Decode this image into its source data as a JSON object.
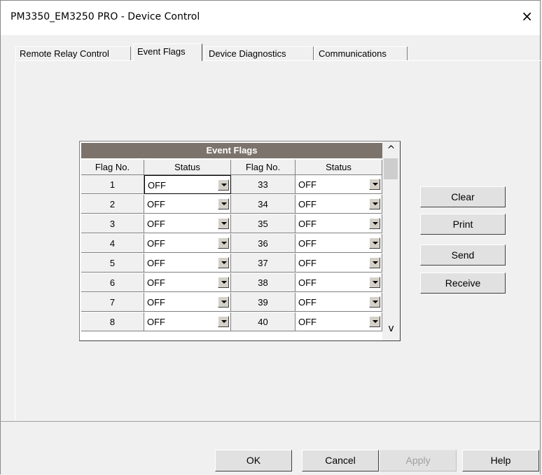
{
  "window": {
    "title": "PM3350_EM3250 PRO - Device Control",
    "close": "×"
  },
  "tabs": [
    {
      "label": "Remote Relay Control"
    },
    {
      "label": "Event Flags"
    },
    {
      "label": "Device Diagnostics"
    },
    {
      "label": "Communications"
    }
  ],
  "grid": {
    "title": "Event Flags",
    "headers": {
      "flag_no": "Flag No.",
      "status": "Status"
    },
    "left": [
      {
        "no": "1",
        "status": "OFF"
      },
      {
        "no": "2",
        "status": "OFF"
      },
      {
        "no": "3",
        "status": "OFF"
      },
      {
        "no": "4",
        "status": "OFF"
      },
      {
        "no": "5",
        "status": "OFF"
      },
      {
        "no": "6",
        "status": "OFF"
      },
      {
        "no": "7",
        "status": "OFF"
      },
      {
        "no": "8",
        "status": "OFF"
      }
    ],
    "right": [
      {
        "no": "33",
        "status": "OFF"
      },
      {
        "no": "34",
        "status": "OFF"
      },
      {
        "no": "35",
        "status": "OFF"
      },
      {
        "no": "36",
        "status": "OFF"
      },
      {
        "no": "37",
        "status": "OFF"
      },
      {
        "no": "38",
        "status": "OFF"
      },
      {
        "no": "39",
        "status": "OFF"
      },
      {
        "no": "40",
        "status": "OFF"
      }
    ],
    "scroll_up": "^",
    "scroll_down": "v"
  },
  "side_buttons": {
    "clear": "Clear",
    "print": "Print",
    "send": "Send",
    "receive": "Receive"
  },
  "footer": {
    "ok": "OK",
    "cancel": "Cancel",
    "apply": "Apply",
    "help": "Help"
  }
}
